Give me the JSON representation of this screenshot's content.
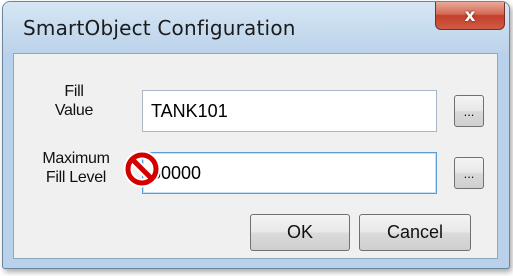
{
  "window": {
    "title": "SmartObject Configuration",
    "close_label": "x"
  },
  "form": {
    "fill_value": {
      "label_line1": "Fill",
      "label_line2": "Value",
      "value": "TANK101",
      "browse_label": "..."
    },
    "max_fill_level": {
      "label_line1": "Maximum",
      "label_line2": "Fill Level",
      "value": "60000",
      "browse_label": "..."
    }
  },
  "buttons": {
    "ok": "OK",
    "cancel": "Cancel"
  },
  "colors": {
    "title_bar": "#bcd3ea",
    "close_button": "#c4402b",
    "client_area": "#f0f0f0",
    "no_cursor": "#d40000"
  },
  "cursor_icon": "not-allowed-cursor-icon"
}
